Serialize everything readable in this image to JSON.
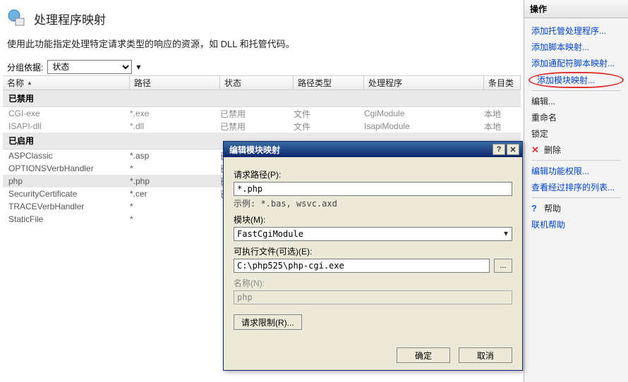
{
  "header": {
    "title": "处理程序映射",
    "description": "使用此功能指定处理特定请求类型的响应的资源，如 DLL 和托管代码。"
  },
  "group": {
    "label": "分组依据:",
    "value": "状态"
  },
  "columns": {
    "name": "名称",
    "path": "路径",
    "state": "状态",
    "ptype": "路径类型",
    "handler": "处理程序",
    "entry": "条目类"
  },
  "sections": {
    "disabled": "已禁用",
    "enabled": "已启用"
  },
  "rows_disabled": [
    {
      "name": "CGI-exe",
      "path": "*.exe",
      "state": "已禁用",
      "ptype": "文件",
      "handler": "CgiModule",
      "entry": "本地"
    },
    {
      "name": "ISAPI-dll",
      "path": "*.dll",
      "state": "已禁用",
      "ptype": "文件",
      "handler": "IsapiModule",
      "entry": "本地"
    }
  ],
  "rows_enabled": [
    {
      "name": "ASPClassic",
      "path": "*.asp",
      "state": "已"
    },
    {
      "name": "OPTIONSVerbHandler",
      "path": "*",
      "state": "已"
    },
    {
      "name": "php",
      "path": "*.php",
      "state": "已",
      "sel": true
    },
    {
      "name": "SecurityCertificate",
      "path": "*.cer",
      "state": "已"
    },
    {
      "name": "TRACEVerbHandler",
      "path": "*",
      "state": ""
    },
    {
      "name": "StaticFile",
      "path": "*",
      "state": ""
    }
  ],
  "actions": {
    "header": "操作",
    "add_managed": "添加托管处理程序...",
    "add_script": "添加脚本映射...",
    "add_wildcard": "添加通配符脚本映射...",
    "add_module": "添加模块映射...",
    "edit": "编辑...",
    "rename": "重命名",
    "lock": "锁定",
    "delete": "删除",
    "edit_perm": "编辑功能权限...",
    "view_ordered": "查看经过排序的列表...",
    "help": "帮助",
    "online_help": "联机帮助"
  },
  "dialog": {
    "title": "编辑模块映射",
    "req_path_label": "请求路径(P):",
    "req_path_value": "*.php",
    "example": "示例: *.bas, wsvc.axd",
    "module_label": "模块(M):",
    "module_value": "FastCgiModule",
    "exe_label": "可执行文件(可选)(E):",
    "exe_value": "C:\\php525\\php-cgi.exe",
    "browse": "...",
    "name_label": "名称(N):",
    "name_value": "php",
    "req_restrict": "请求限制(R)...",
    "ok": "确定",
    "cancel": "取消"
  }
}
